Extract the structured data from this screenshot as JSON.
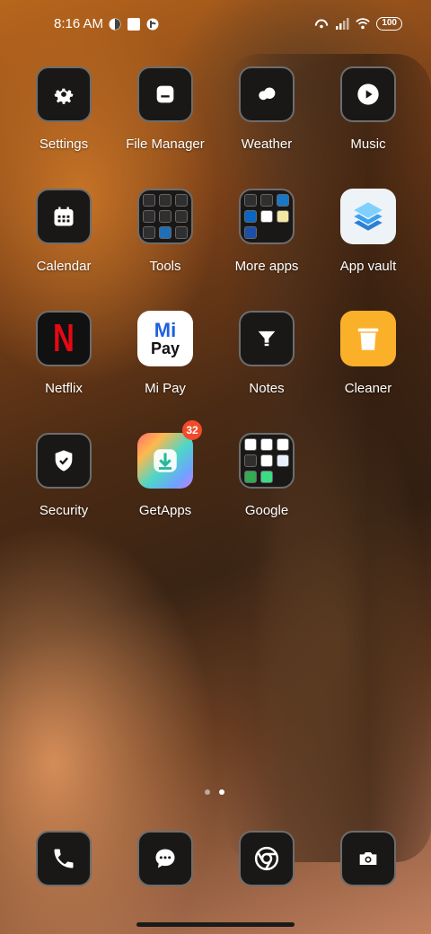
{
  "status": {
    "time": "8:16 AM",
    "battery": "100"
  },
  "apps": [
    {
      "label": "Settings",
      "icon": "gear-icon"
    },
    {
      "label": "File Manager",
      "icon": "folder-icon"
    },
    {
      "label": "Weather",
      "icon": "cloud-icon"
    },
    {
      "label": "Music",
      "icon": "play-icon"
    },
    {
      "label": "Calendar",
      "icon": "calendar-icon"
    },
    {
      "label": "Tools",
      "icon": "tools-folder-icon"
    },
    {
      "label": "More apps",
      "icon": "more-apps-folder-icon"
    },
    {
      "label": "App vault",
      "icon": "app-vault-icon"
    },
    {
      "label": "Netflix",
      "icon": "netflix-icon",
      "glyph": "N"
    },
    {
      "label": "Mi Pay",
      "icon": "mi-pay-icon",
      "glyph_top": "Mi",
      "glyph_bottom": "Pay"
    },
    {
      "label": "Notes",
      "icon": "notes-icon"
    },
    {
      "label": "Cleaner",
      "icon": "trash-icon"
    },
    {
      "label": "Security",
      "icon": "shield-icon"
    },
    {
      "label": "GetApps",
      "icon": "getapps-icon",
      "badge": "32"
    },
    {
      "label": "Google",
      "icon": "google-folder-icon"
    }
  ],
  "dock": [
    {
      "icon": "phone-icon"
    },
    {
      "icon": "messages-icon"
    },
    {
      "icon": "chrome-icon"
    },
    {
      "icon": "camera-icon"
    }
  ],
  "pages": {
    "count": 2,
    "active": 1
  },
  "colors": {
    "icon_bg": "#1a1816",
    "icon_border": "#6d6d6d",
    "badge": "#f24a2a",
    "netflix_red": "#e50914",
    "cleaner_orange": "#fbb02a",
    "app_vault_blue": "#3aa0f0"
  }
}
